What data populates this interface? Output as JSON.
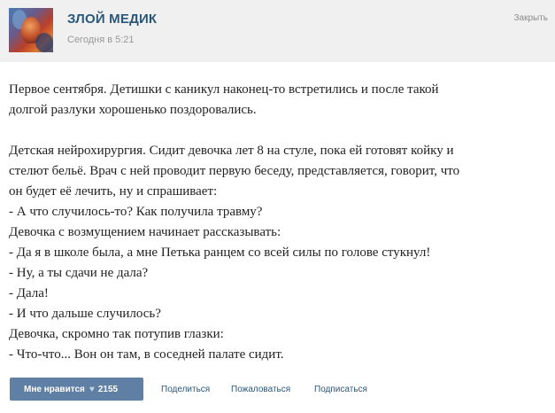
{
  "header": {
    "author": "ЗЛОЙ МЕДИК",
    "timestamp": "Сегодня в 5:21",
    "close_label": "Закрыть"
  },
  "post": {
    "lines": [
      "Первое сентября. Детишки с каникул наконец-то встретились и после такой",
      "долгой разлуки хорошенько поздоровались.",
      "",
      "Детская нейрохирургия. Сидит девочка лет 8 на стуле, пока ей готовят койку и",
      "стелют бельё. Врач с ней проводит первую беседу, представляется, говорит, что",
      "он будет её лечить, ну и спрашивает:",
      "- А что случилось-то? Как получила травму?",
      "Девочка с возмущением начинает рассказывать:",
      "- Да я в школе была, а мне Петька ранцем со всей силы по голове стукнул!",
      "- Ну, а ты сдачи не дала?",
      "- Дала!",
      "- И что дальше случилось?",
      "Девочка, скромно так потупив глазки:",
      "- Что-что... Вон он там, в соседней палате сидит."
    ]
  },
  "footer": {
    "like_label": "Мне нравится",
    "like_count": "2155",
    "share_label": "Поделиться",
    "report_label": "Пожаловаться",
    "subscribe_label": "Подписаться"
  },
  "icons": {
    "like": "heart-icon",
    "avatar": "community-avatar"
  },
  "colors": {
    "accent": "#5f7fa5",
    "link": "#2b587a",
    "header_bg": "#f0f0f0",
    "muted": "#999999"
  }
}
